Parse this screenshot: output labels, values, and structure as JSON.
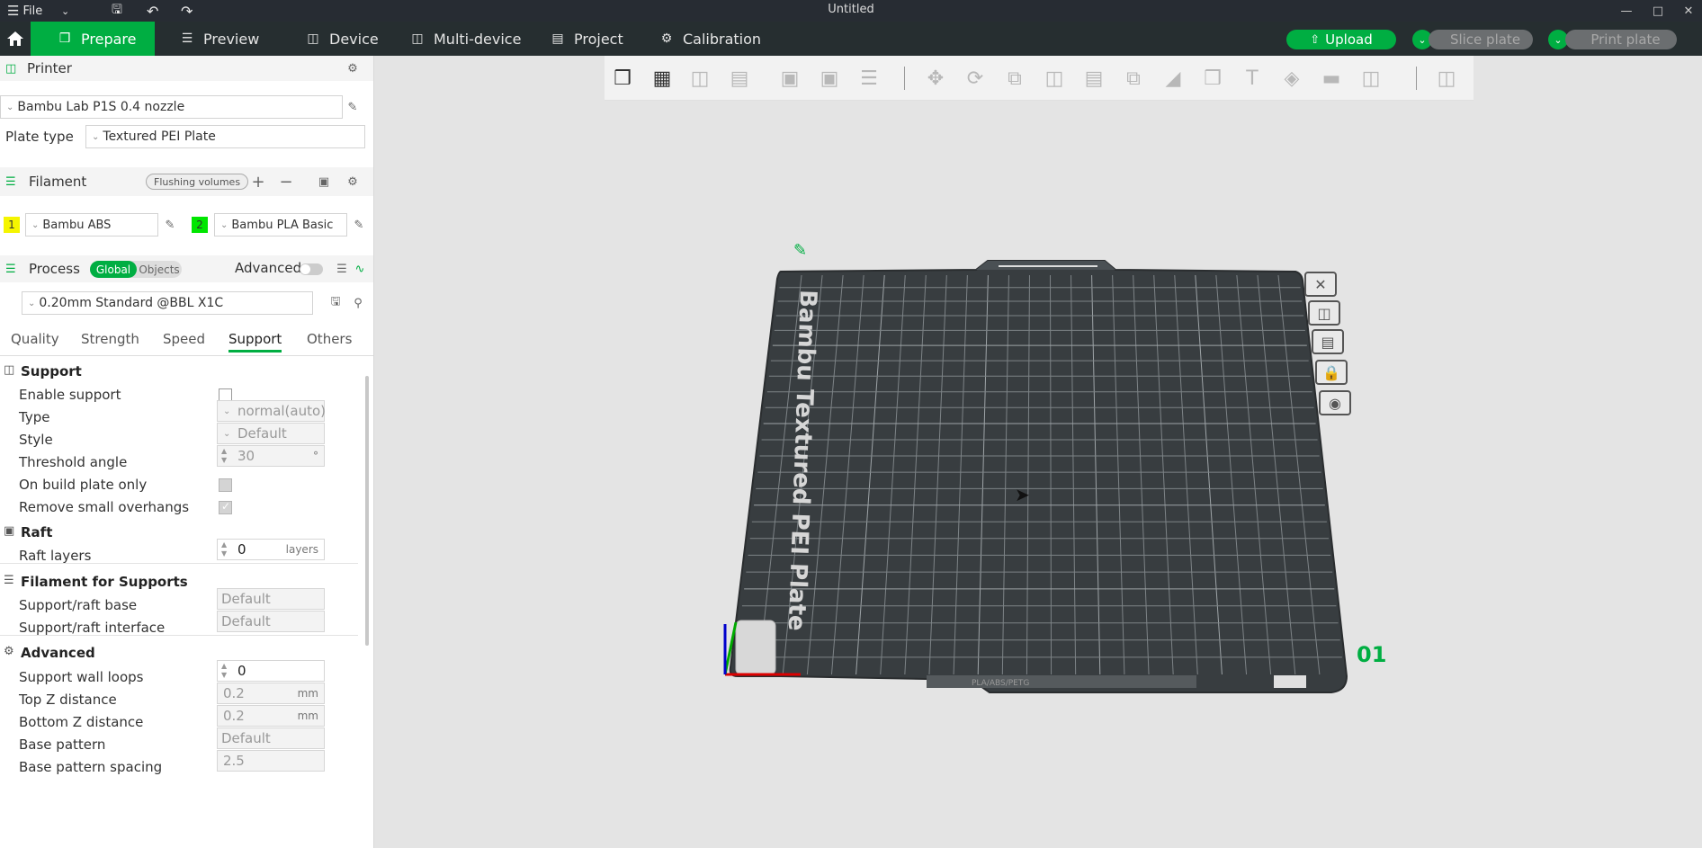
{
  "window": {
    "file_menu": "File",
    "title": "Untitled"
  },
  "nav": {
    "tabs": [
      {
        "label": "Prepare",
        "icon": "cube-icon"
      },
      {
        "label": "Preview",
        "icon": "layers-icon"
      },
      {
        "label": "Device",
        "icon": "device-icon"
      },
      {
        "label": "Multi-device",
        "icon": "multi-device-icon"
      },
      {
        "label": "Project",
        "icon": "project-icon"
      },
      {
        "label": "Calibration",
        "icon": "calibration-icon"
      }
    ],
    "upload_label": "Upload",
    "slice_label": "Slice plate",
    "print_label": "Print plate"
  },
  "printer": {
    "section_label": "Printer",
    "printer_name": "Bambu Lab P1S 0.4 nozzle",
    "plate_type_label": "Plate type",
    "plate_type_value": "Textured PEI Plate"
  },
  "filament": {
    "section_label": "Filament",
    "flushing_label": "Flushing volumes",
    "items": [
      {
        "index": "1",
        "name": "Bambu ABS",
        "color": "#f5f500"
      },
      {
        "index": "2",
        "name": "Bambu PLA Basic",
        "color": "#00e600"
      }
    ]
  },
  "process": {
    "section_label": "Process",
    "global_label": "Global",
    "objects_label": "Objects",
    "advanced_label": "Advanced",
    "preset": "0.20mm Standard @BBL X1C",
    "tabs": [
      "Quality",
      "Strength",
      "Speed",
      "Support",
      "Others"
    ],
    "active_tab": "Support"
  },
  "support": {
    "title": "Support",
    "enable_label": "Enable support",
    "type_label": "Type",
    "type_value": "normal(auto)",
    "style_label": "Style",
    "style_value": "Default",
    "threshold_label": "Threshold angle",
    "threshold_value": "30",
    "threshold_unit": "°",
    "build_plate_only_label": "On build plate only",
    "remove_small_label": "Remove small overhangs"
  },
  "raft": {
    "title": "Raft",
    "layers_label": "Raft layers",
    "layers_value": "0",
    "layers_unit": "layers"
  },
  "filament_supports": {
    "title": "Filament for Supports",
    "base_label": "Support/raft base",
    "base_value": "Default",
    "interface_label": "Support/raft interface",
    "interface_value": "Default"
  },
  "advanced": {
    "title": "Advanced",
    "wall_loops_label": "Support wall loops",
    "wall_loops_value": "0",
    "top_z_label": "Top Z distance",
    "top_z_value": "0.2",
    "top_z_unit": "mm",
    "bottom_z_label": "Bottom Z distance",
    "bottom_z_value": "0.2",
    "bottom_z_unit": "mm",
    "base_pattern_label": "Base pattern",
    "base_pattern_value": "Default",
    "base_pattern_spacing_label": "Base pattern spacing",
    "base_pattern_spacing_value": "2.5"
  },
  "viewport": {
    "plate_label": "Bambu Textured PEI Plate",
    "plate_number": "01",
    "plate_footer_text": "PLA/ABS/PETG"
  }
}
